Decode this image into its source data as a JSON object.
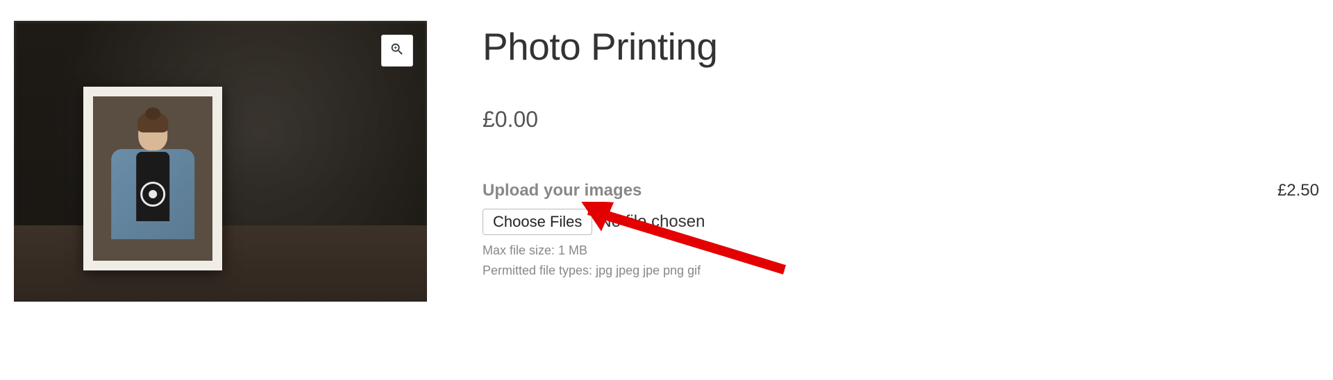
{
  "product": {
    "title": "Photo Printing",
    "price": "£0.00",
    "addon_price": "£2.50"
  },
  "upload": {
    "label": "Upload your images",
    "choose_button": "Choose Files",
    "status": "No file chosen",
    "max_size": "Max file size: 1 MB",
    "permitted": "Permitted file types: jpg jpeg jpe png gif"
  }
}
